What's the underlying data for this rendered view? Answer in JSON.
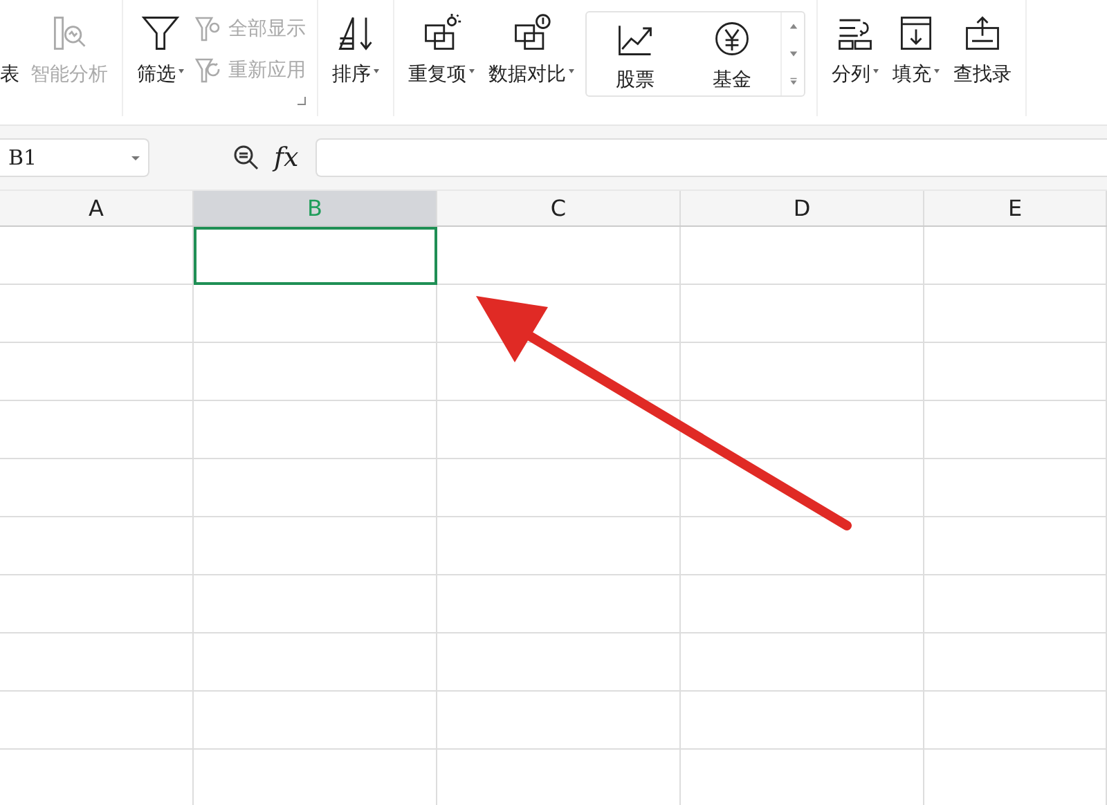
{
  "ribbon": {
    "groups": [
      {
        "items": [
          {
            "kind": "cut",
            "label": "表",
            "disabled": false
          },
          {
            "kind": "large",
            "label": "智能分析",
            "disabled": true
          }
        ]
      },
      {
        "items": [
          {
            "kind": "large",
            "label": "筛选",
            "disabled": false,
            "caret": true
          },
          {
            "kind": "stack",
            "subitems": [
              {
                "label": "全部显示",
                "disabled": true
              },
              {
                "label": "重新应用",
                "disabled": true
              }
            ]
          }
        ],
        "launcher": true
      },
      {
        "items": [
          {
            "kind": "large",
            "label": "排序",
            "disabled": false,
            "caret": true
          }
        ]
      },
      {
        "items": [
          {
            "kind": "large",
            "label": "重复项",
            "disabled": false,
            "caret": true
          },
          {
            "kind": "large",
            "label": "数据对比",
            "disabled": false,
            "caret": true
          },
          {
            "kind": "gallery",
            "entries": [
              {
                "label": "股票"
              },
              {
                "label": "基金"
              }
            ]
          }
        ]
      },
      {
        "items": [
          {
            "kind": "large",
            "label": "分列",
            "disabled": false,
            "caret": true
          },
          {
            "kind": "large",
            "label": "填充",
            "disabled": false,
            "caret": true
          },
          {
            "kind": "large",
            "label": "查找录",
            "disabled": false
          }
        ]
      }
    ]
  },
  "name_box": {
    "value": "B1"
  },
  "formula_bar": {
    "fx": "fx"
  },
  "columns": [
    {
      "label": "A",
      "selected": false
    },
    {
      "label": "B",
      "selected": true
    },
    {
      "label": "C",
      "selected": false
    },
    {
      "label": "D",
      "selected": false
    },
    {
      "label": "E",
      "selected": false
    }
  ]
}
